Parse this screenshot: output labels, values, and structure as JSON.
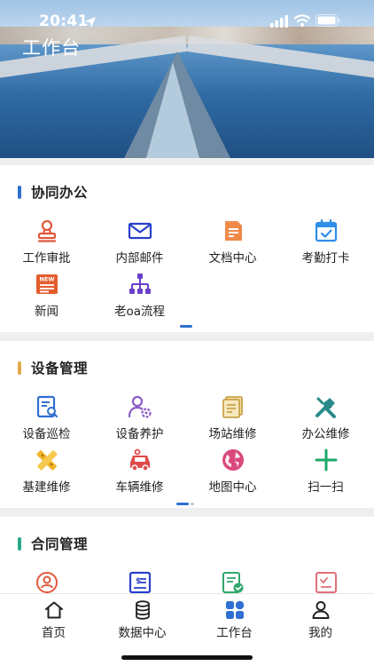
{
  "status_bar": {
    "time": "20:41"
  },
  "header": {
    "title": "工作台"
  },
  "sections": [
    {
      "title": "协同办公",
      "accent": "#2f6fd1",
      "items": [
        {
          "label": "工作审批",
          "icon": "stamp-icon",
          "color": "#e0583c"
        },
        {
          "label": "内部邮件",
          "icon": "mail-icon",
          "color": "#2a40c9"
        },
        {
          "label": "文档中心",
          "icon": "document-icon",
          "color": "#f08a4b"
        },
        {
          "label": "考勤打卡",
          "icon": "calendar-check-icon",
          "color": "#2f8ee8"
        },
        {
          "label": "新闻",
          "icon": "news-icon",
          "color": "#e35d2f",
          "badge": "NEW"
        },
        {
          "label": "老oa流程",
          "icon": "workflow-icon",
          "color": "#6a3fc9"
        }
      ]
    },
    {
      "title": "设备管理",
      "accent": "#e2a94a",
      "items": [
        {
          "label": "设备巡检",
          "icon": "inspection-icon",
          "color": "#2f6fd1"
        },
        {
          "label": "设备养护",
          "icon": "user-gear-icon",
          "color": "#8b5cc9"
        },
        {
          "label": "场站维修",
          "icon": "pages-icon",
          "color": "#c9a24a"
        },
        {
          "label": "办公维修",
          "icon": "tools-icon",
          "color": "#2a8a8a"
        },
        {
          "label": "基建维修",
          "icon": "ruler-pencil-icon",
          "color": "#f0b429"
        },
        {
          "label": "车辆维修",
          "icon": "car-icon",
          "color": "#e04a4a"
        },
        {
          "label": "地图中心",
          "icon": "globe-icon",
          "color": "#d9487c"
        },
        {
          "label": "扫一扫",
          "icon": "plus-scan-icon",
          "color": "#1fa86b"
        }
      ]
    },
    {
      "title": "合同管理",
      "accent": "#2aa889",
      "items": [
        {
          "label": "",
          "icon": "contract-stamp-icon",
          "color": "#e0583c"
        },
        {
          "label": "",
          "icon": "invoice-icon",
          "color": "#2a40c9"
        },
        {
          "label": "",
          "icon": "certificate-icon",
          "color": "#2fa86b"
        },
        {
          "label": "",
          "icon": "checklist-icon",
          "color": "#e0707a"
        }
      ]
    }
  ],
  "tabbar": {
    "items": [
      {
        "label": "首页",
        "icon": "home-icon"
      },
      {
        "label": "数据中心",
        "icon": "database-icon"
      },
      {
        "label": "工作台",
        "icon": "workbench-icon",
        "active": true
      },
      {
        "label": "我的",
        "icon": "user-icon"
      }
    ],
    "active_color": "#2f6fd1"
  }
}
